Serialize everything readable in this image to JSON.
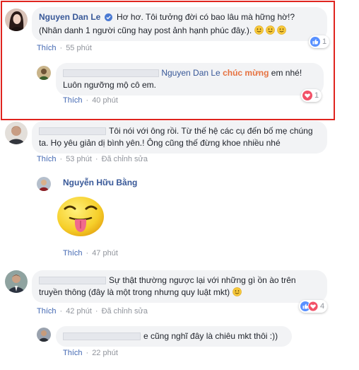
{
  "thread": {
    "c1": {
      "author": "Nguyen Dan Le",
      "text": "Hơ hơ. Tôi tưởng đời có bao lâu mà hững hờ!? (Nhân danh 1 người cũng hay post ảnh hạnh phúc đây.).",
      "emoji_count": 3,
      "action": "Thích",
      "time": "55 phút",
      "reaction_type": "like",
      "reaction_count": "1"
    },
    "r1": {
      "mention": "Nguyen Dan Le",
      "highlight": "chúc mừng",
      "text_after": "em nhé!",
      "line2": "Luôn ngưỡng mộ cô em.",
      "action": "Thích",
      "time": "40 phút",
      "reaction_type": "love",
      "reaction_count": "1"
    },
    "c2": {
      "text": "Tôi nói với ông rồi. Từ thế hệ các cụ đến bố mẹ chúng ta. Họ yêu giản dị bình yên.! Ông cũng thế đừng khoe nhiều nhé",
      "action": "Thích",
      "time": "53 phút",
      "edited": "Đã chỉnh sửa"
    },
    "r2": {
      "author": "Nguyễn Hữu Bằng",
      "sticker": "tongue-out-smiley",
      "action": "Thích",
      "time": "47 phút"
    },
    "c3": {
      "text": "Sự thật thường ngược lại với những gì ồn ào trên truyền thông (đây là một trong nhưng quy luật mkt)",
      "action": "Thích",
      "time": "42 phút",
      "edited": "Đã chỉnh sửa",
      "reaction_types": [
        "like",
        "love"
      ],
      "reaction_count": "4"
    },
    "r3": {
      "text": "e cũng nghĩ đây là chiêu mkt thôi :))",
      "action": "Thích",
      "time": "22 phút"
    }
  },
  "colors": {
    "highlight_border": "#e0241f",
    "link": "#385898",
    "mention_orange": "#e6713f",
    "like_blue": "#5890ff",
    "love_red": "#f25268"
  }
}
